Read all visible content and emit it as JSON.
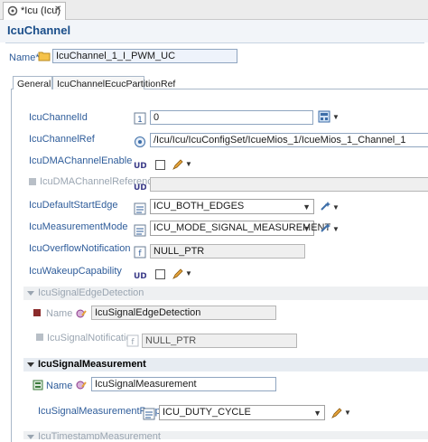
{
  "editor_tab": {
    "title": "*Icu (Icu)",
    "close": "✕"
  },
  "page_title": "IcuChannel",
  "name_row": {
    "label": "Name*",
    "value": "IcuChannel_1_I_PWM_UC"
  },
  "inner_tabs": [
    {
      "label": "General"
    },
    {
      "label": "IcuChannelEcucPartitionRef"
    }
  ],
  "rows": {
    "channel_id": {
      "label": "IcuChannelId",
      "value": "0"
    },
    "channel_ref": {
      "label": "IcuChannelRef",
      "value": "/Icu/Icu/IcuConfigSet/IcueMios_1/IcueMios_1_Channel_1"
    },
    "dma_enable": {
      "label": "IcuDMAChannelEnable"
    },
    "dma_reference": {
      "label": "IcuDMAChannelReference"
    },
    "default_start_edge": {
      "label": "IcuDefaultStartEdge",
      "value": "ICU_BOTH_EDGES"
    },
    "measurement_mode": {
      "label": "IcuMeasurementMode",
      "value": "ICU_MODE_SIGNAL_MEASUREMENT"
    },
    "overflow_notification": {
      "label": "IcuOverflowNotification",
      "value": "NULL_PTR"
    },
    "wakeup_capability": {
      "label": "IcuWakeupCapability"
    }
  },
  "edge_detection": {
    "header": "IcuSignalEdgeDetection",
    "name_label": "Name",
    "name_value": "IcuSignalEdgeDetection",
    "notif_label": "IcuSignalNotification",
    "notif_value": "NULL_PTR"
  },
  "signal_measurement": {
    "header": "IcuSignalMeasurement",
    "name_label": "Name",
    "name_value": "IcuSignalMeasurement",
    "property_label": "IcuSignalMeasurementProperty",
    "property_value": "ICU_DUTY_CYCLE"
  },
  "timestamp_section": {
    "header": "IcuTimestampMeasurement"
  },
  "colors": {
    "label_blue": "#2e5c9a",
    "title_blue": "#1a4e8a",
    "disabled": "#9aa5b1"
  }
}
